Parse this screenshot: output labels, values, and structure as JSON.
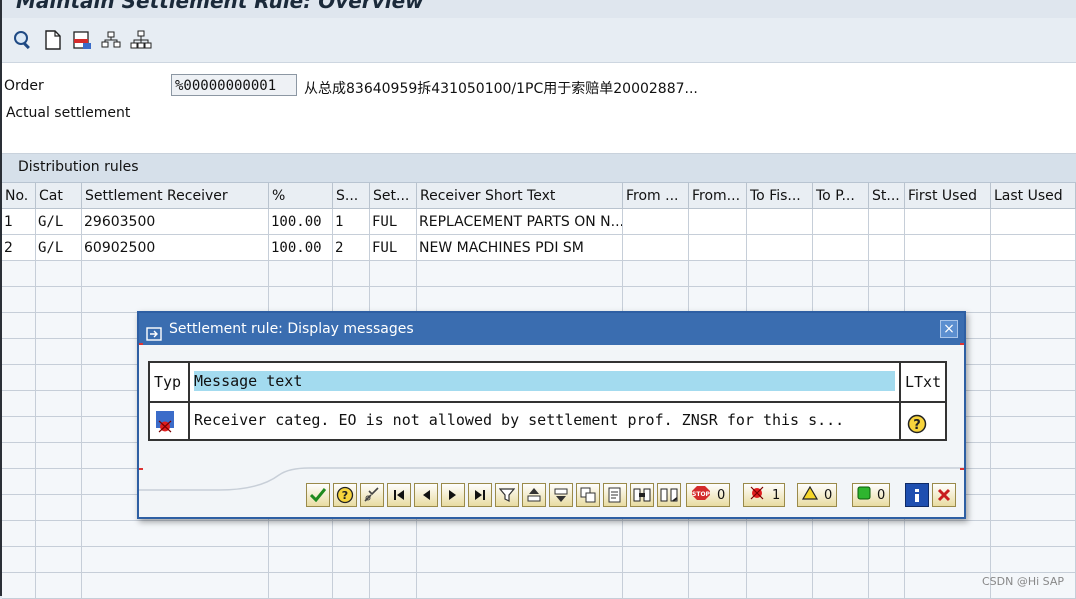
{
  "window": {
    "title": "Maintain Settlement Rule: Overview"
  },
  "toolbar": {
    "icons": [
      "magnifier-icon",
      "new-document-icon",
      "print-icon",
      "hierarchy-icon",
      "org-structure-icon"
    ]
  },
  "header": {
    "order_label": "Order",
    "order_value": "%00000000001",
    "order_description": "从总成83640959拆431050100/1PC用于索赔单20002887...",
    "settlement_type": "Actual settlement"
  },
  "distribution": {
    "section_title": "Distribution rules",
    "columns": [
      "No.",
      "Cat",
      "Settlement Receiver",
      "%",
      "S...",
      "Set...",
      "Receiver Short Text",
      "From ...",
      "From...",
      "To Fis...",
      "To P...",
      "St...",
      "First Used",
      "Last Used"
    ],
    "rows": [
      {
        "no": "1",
        "cat": "G/L",
        "receiver": "29603500",
        "pct": "100.00",
        "s": "1",
        "set": "FUL",
        "text": "REPLACEMENT PARTS ON N..."
      },
      {
        "no": "2",
        "cat": "G/L",
        "receiver": "60902500",
        "pct": "100.00",
        "s": "2",
        "set": "FUL",
        "text": "NEW MACHINES PDI SM"
      }
    ]
  },
  "dialog": {
    "title": "Settlement rule: Display messages",
    "close": "×",
    "header_typ": "Typ",
    "header_text": "Message text",
    "header_ltxt": "LTxt",
    "message": "Receiver categ. EO is not allowed by settlement prof. ZNSR for this s...",
    "counts": {
      "stop": "0",
      "error": "1",
      "warning": "0",
      "success": "0"
    }
  },
  "watermark": "CSDN @Hi SAP"
}
